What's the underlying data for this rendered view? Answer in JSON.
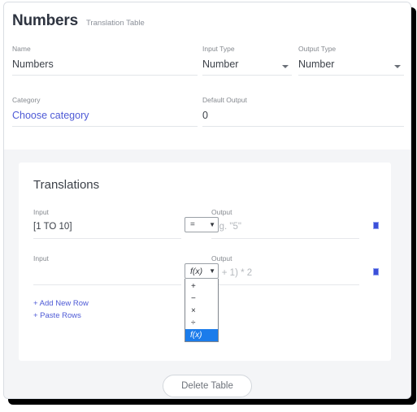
{
  "header": {
    "title": "Numbers",
    "subtitle": "Translation Table"
  },
  "form": {
    "name": {
      "label": "Name",
      "value": "Numbers"
    },
    "input_type": {
      "label": "Input Type",
      "value": "Number"
    },
    "output_type": {
      "label": "Output Type",
      "value": "Number"
    },
    "category": {
      "label": "Category",
      "value": "Choose category"
    },
    "default_output": {
      "label": "Default Output",
      "value": "0"
    }
  },
  "translations": {
    "title": "Translations",
    "columns": {
      "input": "Input",
      "output": "Output"
    },
    "rows": [
      {
        "input_value": "[1 TO 10]",
        "operator": "=",
        "output_value": "",
        "output_placeholder": "e.g. \"5\""
      },
      {
        "input_value": "",
        "operator": "f(x)",
        "output_value": "",
        "output_placeholder": "(x + 1) * 2"
      }
    ],
    "operator_options": [
      "+",
      "−",
      "×",
      "÷",
      "f(x)"
    ],
    "operator_selected": "f(x)",
    "add_new_row": "+ Add New Row",
    "paste_rows": "+ Paste Rows"
  },
  "footer": {
    "delete_label": "Delete Table"
  },
  "colors": {
    "link": "#4e5ad6",
    "highlight": "#1b7ceb",
    "marker": "#3b4fd8"
  }
}
